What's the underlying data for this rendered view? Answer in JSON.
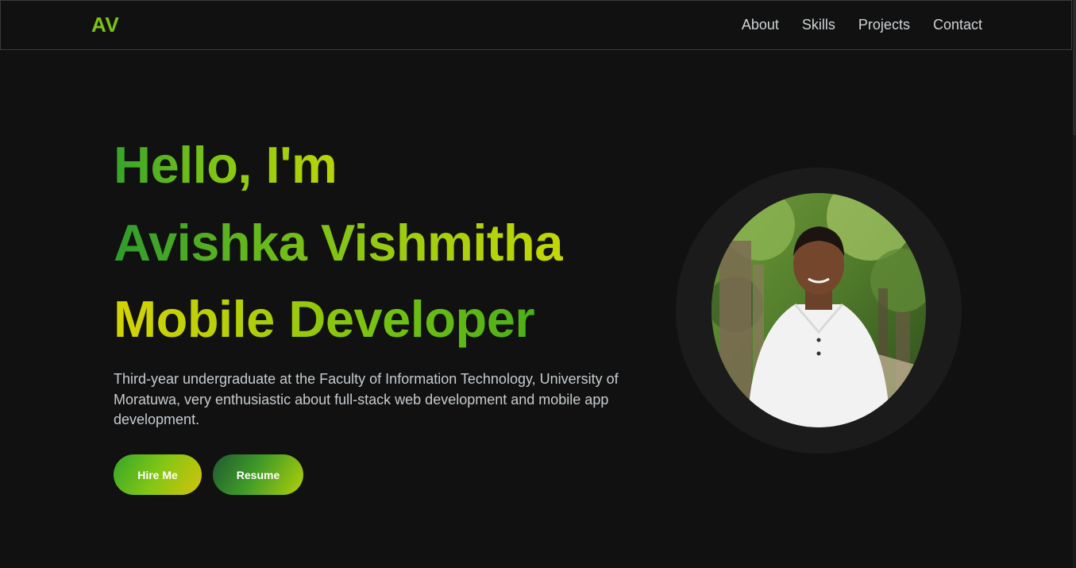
{
  "header": {
    "logo": "AV",
    "nav": [
      "About",
      "Skills",
      "Projects",
      "Contact"
    ]
  },
  "hero": {
    "greeting": "Hello, I'm",
    "name": "Avishka Vishmitha",
    "role": "Mobile Developer",
    "bio": "Third-year undergraduate at the Faculty of Information Technology, University of Moratuwa, very enthusiastic about full-stack web development and mobile app development.",
    "buttons": {
      "hire": "Hire Me",
      "resume": "Resume"
    }
  },
  "colors": {
    "background": "#111111",
    "accent_green": "#7cc413",
    "accent_yellow": "#d4d305",
    "text_muted": "#c7ccd0"
  },
  "icons": [
    "profile-photo"
  ]
}
